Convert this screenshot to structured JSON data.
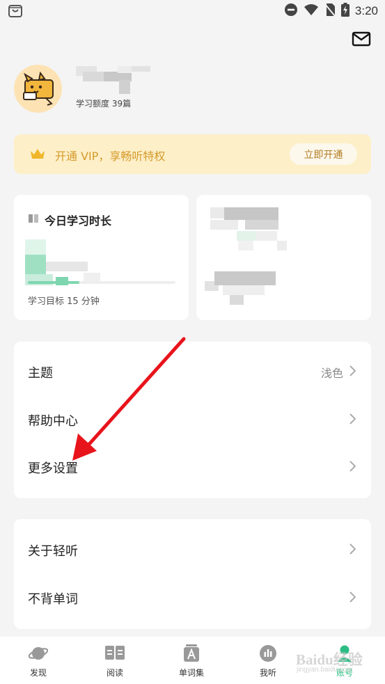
{
  "status_bar": {
    "time": "3:20",
    "icons": [
      "app-notification-icon",
      "do-not-disturb-icon",
      "wifi-icon",
      "no-sim-icon",
      "battery-charging-icon"
    ]
  },
  "header": {
    "mail_icon": "mail-icon"
  },
  "profile": {
    "quota_text": "学习额度 39篇",
    "avatar_icon": "dog-avatar-icon"
  },
  "vip_banner": {
    "text": "开通 VIP，享畅听特权",
    "button_label": "立即开通",
    "crown_icon": "crown-icon",
    "bg_color": "#fdefc8",
    "text_color": "#d59a2a"
  },
  "study_card": {
    "title": "今日学习时长",
    "goal_text": "学习目标 15 分钟",
    "progress_fraction": 0.35,
    "icon": "book-icon"
  },
  "menu_group_1": [
    {
      "label": "主题",
      "value": "浅色"
    },
    {
      "label": "帮助中心",
      "value": ""
    },
    {
      "label": "更多设置",
      "value": ""
    }
  ],
  "menu_group_2": [
    {
      "label": "关于轻听",
      "value": ""
    },
    {
      "label": "不背单词",
      "value": ""
    }
  ],
  "tabs": [
    {
      "label": "发现",
      "icon": "planet-icon"
    },
    {
      "label": "阅读",
      "icon": "open-book-icon"
    },
    {
      "label": "单词集",
      "icon": "word-card-icon"
    },
    {
      "label": "我听",
      "icon": "audio-bars-icon"
    },
    {
      "label": "账号",
      "icon": "account-icon",
      "active": true
    }
  ],
  "colors": {
    "accent": "#2bbd83",
    "annotation_arrow": "#e8141b"
  },
  "watermark": {
    "text": "Baidu经验",
    "sub": "jingyan.baidu.com"
  }
}
